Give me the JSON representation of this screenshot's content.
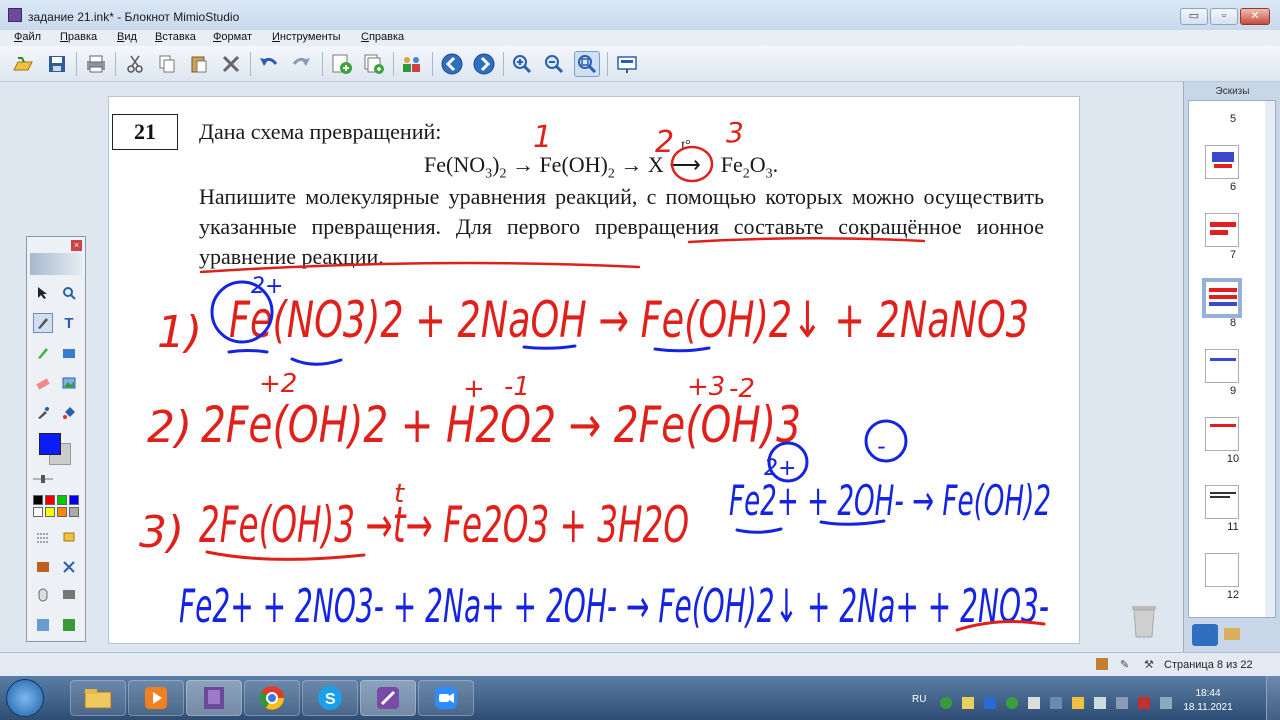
{
  "window": {
    "title": "задание 21.ink* - Блокнот MimioStudio",
    "controls": {
      "minimize": "▭",
      "maximize": "▫",
      "close": "✕"
    }
  },
  "menu": [
    "Файл",
    "Правка",
    "Вид",
    "Вставка",
    "Формат",
    "Инструменты",
    "Справка"
  ],
  "toolbar_icons": [
    "open-icon",
    "save-icon",
    "print-icon",
    "cut-icon",
    "copy-icon",
    "paste-icon",
    "delete-icon",
    "undo-icon",
    "redo-icon",
    "new-page-icon",
    "duplicate-page-icon",
    "users-icon",
    "back-icon",
    "forward-icon",
    "zoom-in-icon",
    "zoom-out-icon",
    "zoom-fit-icon",
    "presentation-icon"
  ],
  "task": {
    "number": "21",
    "intro": "Дана схема превращений:",
    "scheme": "Fe(NO₃)₂ → Fe(OH)₂ → X →t°→ Fe₂O₃.",
    "scheme_parts": {
      "a": "Fe(NO",
      "a_sub": "3",
      "a_close": ")",
      "a_sub2": "2",
      "b": "Fe(OH)",
      "b_sub": "2",
      "x": "X",
      "t": "t°",
      "c": "Fe",
      "c_sub": "2",
      "c_mid": "O",
      "c_sub2": "3",
      "c_end": "."
    },
    "instruction": "Напишите молекулярные уравнения реакций, с помощью которых можно осуществить указанные превращения. Для первого превращения составьте сокращённое ионное уравнение реакции."
  },
  "handwriting": {
    "marks": [
      "1",
      "2",
      "3"
    ],
    "line1": {
      "num": "1)",
      "text": "Fe(NO3)2 + 2NaOH → Fe(OH)2↓ + 2NaNO3",
      "charge": "2+"
    },
    "line2": {
      "num": "2)",
      "text": "2Fe(OH)2 + H2O2 → 2Fe(OH)3",
      "charges": [
        "+2",
        "+",
        "-1",
        "+3",
        "-2"
      ]
    },
    "line3": {
      "num": "3)",
      "text": "2Fe(OH)3 →t→ Fe2O3 + 3H2O",
      "t": "t"
    },
    "ionic_short": {
      "text": "Fe2+ + 2OH- → Fe(OH)2",
      "charges": [
        "2+",
        "-"
      ]
    },
    "ionic_full": {
      "text": "Fe2+ + 2NO3- + 2Na+ + 2OH- → Fe(OH)2↓ + 2Na+ + 2NO3-"
    }
  },
  "thumbnails": {
    "title": "Эскизы",
    "pages": [
      "5",
      "6",
      "7",
      "8",
      "9",
      "10",
      "11",
      "12"
    ],
    "selected": "8"
  },
  "status": {
    "page_text": "Страница 8 из 22"
  },
  "taskbar": {
    "apps": [
      "explorer",
      "media-player",
      "mimio-notebook",
      "chrome",
      "skype",
      "mimio-studio",
      "zoom"
    ],
    "lang": "RU",
    "time": "18:44",
    "date": "18.11.2021"
  },
  "colors": {
    "ink_red": "#e0201a",
    "ink_blue": "#1424e0",
    "selected_color": "#0b1cf5"
  }
}
